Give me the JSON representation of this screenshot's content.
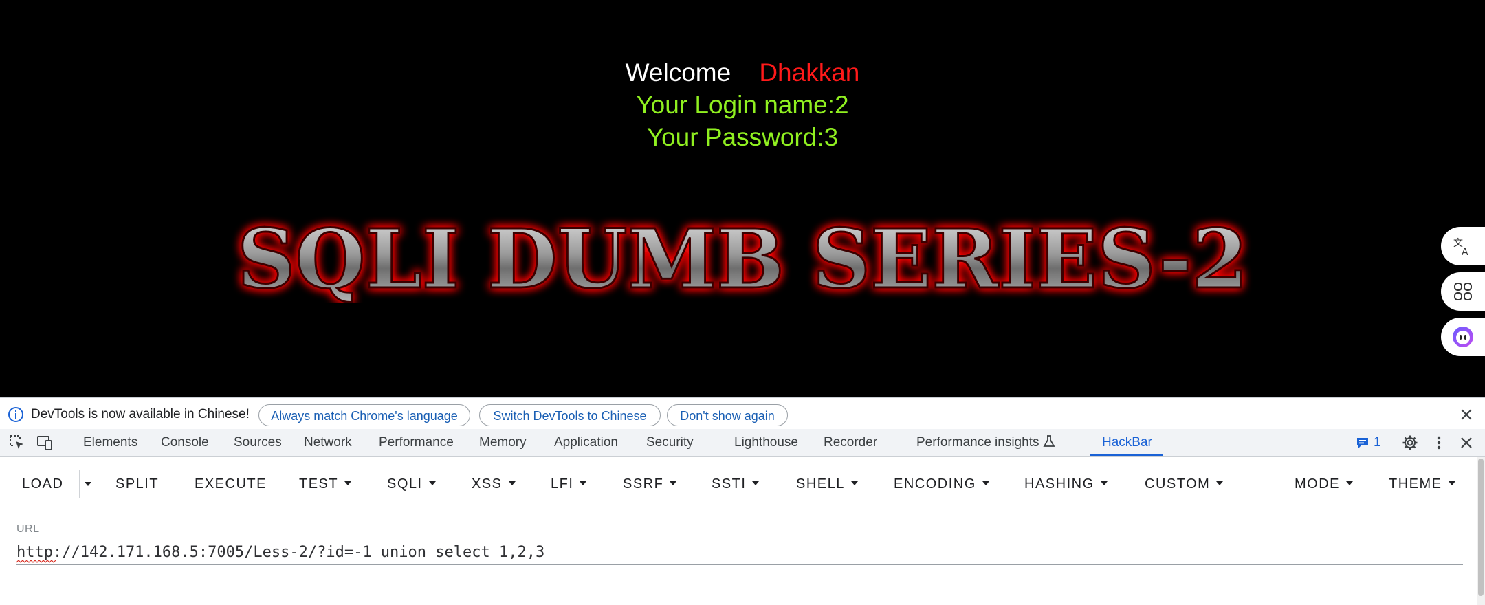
{
  "page": {
    "welcome_word": "Welcome",
    "welcome_name": "Dhakkan",
    "login_line": "Your Login name:2",
    "password_line": "Your Password:3",
    "banner_text": "SQLI DUMB SERIES-2"
  },
  "side_buttons": [
    "translate-icon",
    "apps-icon",
    "assistant-icon"
  ],
  "infobar": {
    "message": "DevTools is now available in Chinese!",
    "buttons": [
      "Always match Chrome's language",
      "Switch DevTools to Chinese",
      "Don't show again"
    ]
  },
  "devtools_tabs": {
    "items": [
      "Elements",
      "Console",
      "Sources",
      "Network",
      "Performance",
      "Memory",
      "Application",
      "Security",
      "Lighthouse",
      "Recorder",
      "Performance insights",
      "HackBar"
    ],
    "active": "HackBar",
    "issues_count": "1"
  },
  "hackbar": {
    "buttons": [
      "LOAD",
      "SPLIT",
      "EXECUTE",
      "TEST",
      "SQLI",
      "XSS",
      "LFI",
      "SSRF",
      "SSTI",
      "SHELL",
      "ENCODING",
      "HASHING",
      "CUSTOM",
      "MODE",
      "THEME"
    ],
    "url_label": "URL",
    "url_value": "http://142.171.168.5:7005/Less-2/?id=-1 union select 1,2,3"
  },
  "colors": {
    "welcome_name": "#ff1a1a",
    "green_text": "#90f020",
    "active_tab": "#1a62d6",
    "link_text": "#1a5fb4"
  }
}
